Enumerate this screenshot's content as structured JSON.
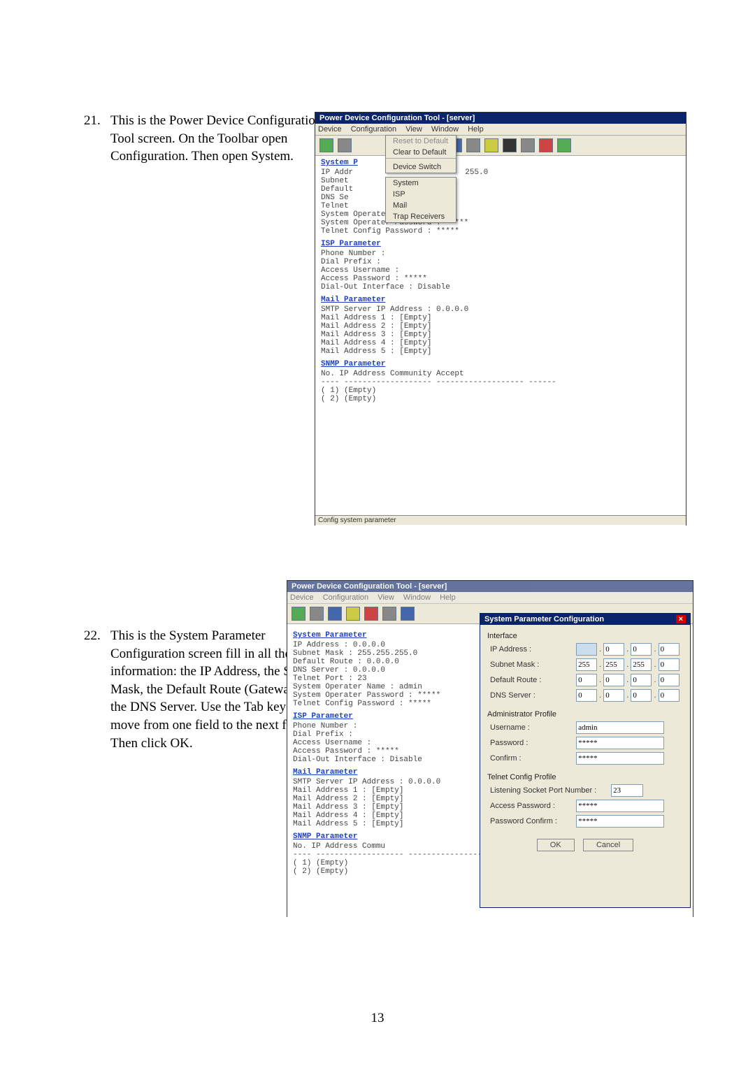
{
  "page_number": "13",
  "steps": [
    {
      "n": "21.",
      "text": "This is the Power Device Configuration Tool screen.  On the Toolbar open Configuration.  Then open System."
    },
    {
      "n": "22.",
      "text": "This is the System Parameter Configuration screen fill in all the information:  the IP Address, the Subnet Mask, the Default Route (Gateway) and the DNS Server.  Use the Tab key to move from one field to the next field.  Then click OK."
    }
  ],
  "app": {
    "title1": "Power Device Configuration Tool - [server]",
    "title2": "Power Device Configuration Tool - [server]",
    "menus": [
      "Device",
      "Configuration",
      "View",
      "Window",
      "Help"
    ]
  },
  "config_menu": {
    "items": [
      "Reset to Default",
      "Clear to Default",
      "Device Switch"
    ],
    "sub": [
      "System",
      "ISP",
      "Mail",
      "Trap Receivers"
    ]
  },
  "sys_section": {
    "heading": "System Parameter",
    "lines": [
      "IP Address    : 0.0.0.0",
      "Subnet Mask   : 255.255.255.0",
      "Default Route : 0.0.0.0",
      "DNS Server    : 0.0.0.0",
      "Telnet Port   : 23",
      "System Operater Name     : admin",
      "System Operater Password : *****",
      "Telnet Config Password   : *****"
    ],
    "partial": [
      "IP Addr",
      "Subnet",
      "Default",
      "DNS Se",
      "Telnet"
    ],
    "mask_fragment": "255.0"
  },
  "isp_section": {
    "heading": "ISP Parameter",
    "lines": [
      "Phone Number  :",
      "Dial Prefix   :",
      "Access Username    :",
      "Access Password    : *****",
      "Dial-Out Interface : Disable"
    ]
  },
  "mail_section": {
    "heading": "Mail Parameter",
    "lines": [
      "SMTP Server IP Address : 0.0.0.0",
      "Mail Address  1 : [Empty]",
      "Mail Address  2 : [Empty]",
      "Mail Address  3 : [Empty]",
      "Mail Address  4 : [Empty]",
      "Mail Address  5 : [Empty]"
    ]
  },
  "snmp_section": {
    "heading": "SNMP Parameter",
    "header": "No.   IP  Address          Community        Accept",
    "header2": "No.   IP  Address          Commu",
    "rule": "---- ------------------- ------------------- ------",
    "rows": [
      "( 1)  (Empty)",
      "( 2)  (Empty)"
    ]
  },
  "status_text": "Config system parameter",
  "dialog": {
    "title": "System Parameter Configuration",
    "sect_iface": "Interface",
    "lbl_ip": "IP Address :",
    "lbl_mask": "Subnet Mask :",
    "lbl_route": "Default Route :",
    "lbl_dns": "DNS Server :",
    "ip": [
      "",
      "0",
      "0",
      "0"
    ],
    "mask": [
      "255",
      "255",
      "255",
      "0"
    ],
    "route": [
      "0",
      "0",
      "0",
      "0"
    ],
    "dns": [
      "0",
      "0",
      "0",
      "0"
    ],
    "sect_admin": "Administrator Profile",
    "lbl_user": "Username :",
    "val_user": "admin",
    "lbl_pwd": "Password :",
    "val_pwd": "*****",
    "lbl_conf": "Confirm :",
    "val_conf": "*****",
    "sect_telnet": "Telnet Config Profile",
    "lbl_port": "Listening Socket Port Number :",
    "val_port": "23",
    "lbl_apwd": "Access Password :",
    "val_apwd": "*****",
    "lbl_aconf": "Password Confirm :",
    "val_aconf": "*****",
    "ok": "OK",
    "cancel": "Cancel"
  }
}
